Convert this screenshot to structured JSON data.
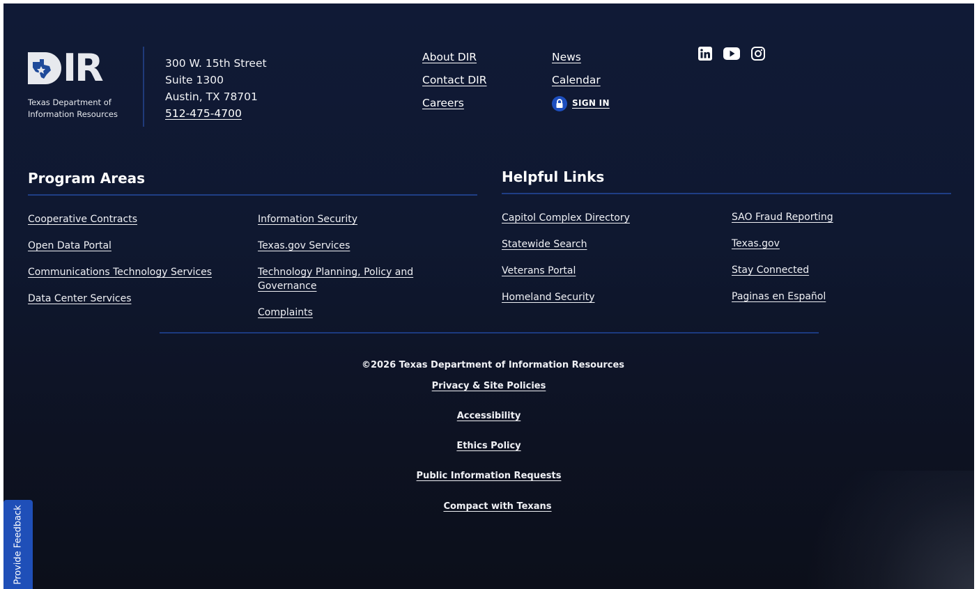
{
  "logo": {
    "mark": "DIR",
    "org_name_line1": "Texas Department of",
    "org_name_line2": "Information Resources"
  },
  "address": {
    "street": "300 W. 15th Street",
    "suite": "Suite 1300",
    "city": "Austin, TX 78701",
    "phone": "512-475-4700"
  },
  "top_links": {
    "col_a": [
      "About DIR",
      "Contact DIR",
      "Careers"
    ],
    "col_b": [
      "News",
      "Calendar"
    ],
    "sign_in": "SIGN IN"
  },
  "social": [
    "linkedin-icon",
    "youtube-icon",
    "instagram-icon"
  ],
  "program_areas": {
    "title": "Program Areas",
    "col1": [
      "Cooperative Contracts",
      "Open Data Portal",
      "Communications Technology Services",
      "Data Center Services"
    ],
    "col2": [
      "Information Security",
      "Texas.gov Services",
      "Technology Planning, Policy and Governance",
      "Complaints"
    ]
  },
  "helpful_links": {
    "title": "Helpful Links",
    "col1": [
      "Capitol Complex Directory",
      "Statewide Search",
      "Veterans Portal",
      "Homeland Security"
    ],
    "col2": [
      "SAO Fraud Reporting",
      "Texas.gov",
      "Stay Connected",
      "Paginas en Español"
    ]
  },
  "copyright": "©2026 Texas Department of Information Resources",
  "legal_links": [
    "Privacy & Site Policies",
    "Accessibility",
    "Ethics Policy",
    "Public Information Requests",
    "Compact with Texans"
  ],
  "feedback_tab": "Provide Feedback",
  "colors": {
    "background": "#0f1830",
    "accent": "#1f4fb8",
    "rule": "#1f3e85",
    "text": "#ffffff"
  }
}
